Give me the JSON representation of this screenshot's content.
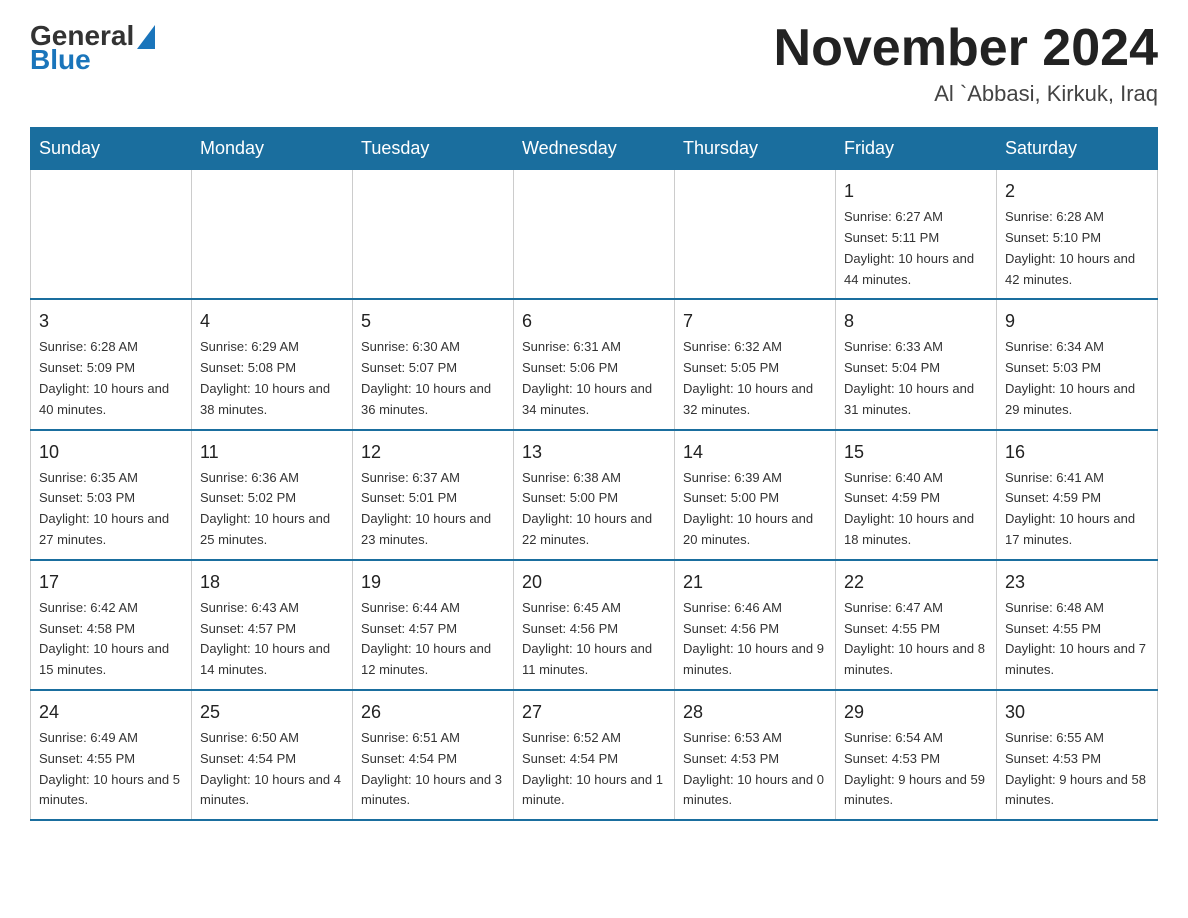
{
  "logo": {
    "general": "General",
    "blue": "Blue"
  },
  "title": "November 2024",
  "subtitle": "Al `Abbasi, Kirkuk, Iraq",
  "days_of_week": [
    "Sunday",
    "Monday",
    "Tuesday",
    "Wednesday",
    "Thursday",
    "Friday",
    "Saturday"
  ],
  "weeks": [
    [
      {
        "day": "",
        "info": ""
      },
      {
        "day": "",
        "info": ""
      },
      {
        "day": "",
        "info": ""
      },
      {
        "day": "",
        "info": ""
      },
      {
        "day": "",
        "info": ""
      },
      {
        "day": "1",
        "info": "Sunrise: 6:27 AM\nSunset: 5:11 PM\nDaylight: 10 hours and 44 minutes."
      },
      {
        "day": "2",
        "info": "Sunrise: 6:28 AM\nSunset: 5:10 PM\nDaylight: 10 hours and 42 minutes."
      }
    ],
    [
      {
        "day": "3",
        "info": "Sunrise: 6:28 AM\nSunset: 5:09 PM\nDaylight: 10 hours and 40 minutes."
      },
      {
        "day": "4",
        "info": "Sunrise: 6:29 AM\nSunset: 5:08 PM\nDaylight: 10 hours and 38 minutes."
      },
      {
        "day": "5",
        "info": "Sunrise: 6:30 AM\nSunset: 5:07 PM\nDaylight: 10 hours and 36 minutes."
      },
      {
        "day": "6",
        "info": "Sunrise: 6:31 AM\nSunset: 5:06 PM\nDaylight: 10 hours and 34 minutes."
      },
      {
        "day": "7",
        "info": "Sunrise: 6:32 AM\nSunset: 5:05 PM\nDaylight: 10 hours and 32 minutes."
      },
      {
        "day": "8",
        "info": "Sunrise: 6:33 AM\nSunset: 5:04 PM\nDaylight: 10 hours and 31 minutes."
      },
      {
        "day": "9",
        "info": "Sunrise: 6:34 AM\nSunset: 5:03 PM\nDaylight: 10 hours and 29 minutes."
      }
    ],
    [
      {
        "day": "10",
        "info": "Sunrise: 6:35 AM\nSunset: 5:03 PM\nDaylight: 10 hours and 27 minutes."
      },
      {
        "day": "11",
        "info": "Sunrise: 6:36 AM\nSunset: 5:02 PM\nDaylight: 10 hours and 25 minutes."
      },
      {
        "day": "12",
        "info": "Sunrise: 6:37 AM\nSunset: 5:01 PM\nDaylight: 10 hours and 23 minutes."
      },
      {
        "day": "13",
        "info": "Sunrise: 6:38 AM\nSunset: 5:00 PM\nDaylight: 10 hours and 22 minutes."
      },
      {
        "day": "14",
        "info": "Sunrise: 6:39 AM\nSunset: 5:00 PM\nDaylight: 10 hours and 20 minutes."
      },
      {
        "day": "15",
        "info": "Sunrise: 6:40 AM\nSunset: 4:59 PM\nDaylight: 10 hours and 18 minutes."
      },
      {
        "day": "16",
        "info": "Sunrise: 6:41 AM\nSunset: 4:59 PM\nDaylight: 10 hours and 17 minutes."
      }
    ],
    [
      {
        "day": "17",
        "info": "Sunrise: 6:42 AM\nSunset: 4:58 PM\nDaylight: 10 hours and 15 minutes."
      },
      {
        "day": "18",
        "info": "Sunrise: 6:43 AM\nSunset: 4:57 PM\nDaylight: 10 hours and 14 minutes."
      },
      {
        "day": "19",
        "info": "Sunrise: 6:44 AM\nSunset: 4:57 PM\nDaylight: 10 hours and 12 minutes."
      },
      {
        "day": "20",
        "info": "Sunrise: 6:45 AM\nSunset: 4:56 PM\nDaylight: 10 hours and 11 minutes."
      },
      {
        "day": "21",
        "info": "Sunrise: 6:46 AM\nSunset: 4:56 PM\nDaylight: 10 hours and 9 minutes."
      },
      {
        "day": "22",
        "info": "Sunrise: 6:47 AM\nSunset: 4:55 PM\nDaylight: 10 hours and 8 minutes."
      },
      {
        "day": "23",
        "info": "Sunrise: 6:48 AM\nSunset: 4:55 PM\nDaylight: 10 hours and 7 minutes."
      }
    ],
    [
      {
        "day": "24",
        "info": "Sunrise: 6:49 AM\nSunset: 4:55 PM\nDaylight: 10 hours and 5 minutes."
      },
      {
        "day": "25",
        "info": "Sunrise: 6:50 AM\nSunset: 4:54 PM\nDaylight: 10 hours and 4 minutes."
      },
      {
        "day": "26",
        "info": "Sunrise: 6:51 AM\nSunset: 4:54 PM\nDaylight: 10 hours and 3 minutes."
      },
      {
        "day": "27",
        "info": "Sunrise: 6:52 AM\nSunset: 4:54 PM\nDaylight: 10 hours and 1 minute."
      },
      {
        "day": "28",
        "info": "Sunrise: 6:53 AM\nSunset: 4:53 PM\nDaylight: 10 hours and 0 minutes."
      },
      {
        "day": "29",
        "info": "Sunrise: 6:54 AM\nSunset: 4:53 PM\nDaylight: 9 hours and 59 minutes."
      },
      {
        "day": "30",
        "info": "Sunrise: 6:55 AM\nSunset: 4:53 PM\nDaylight: 9 hours and 58 minutes."
      }
    ]
  ]
}
